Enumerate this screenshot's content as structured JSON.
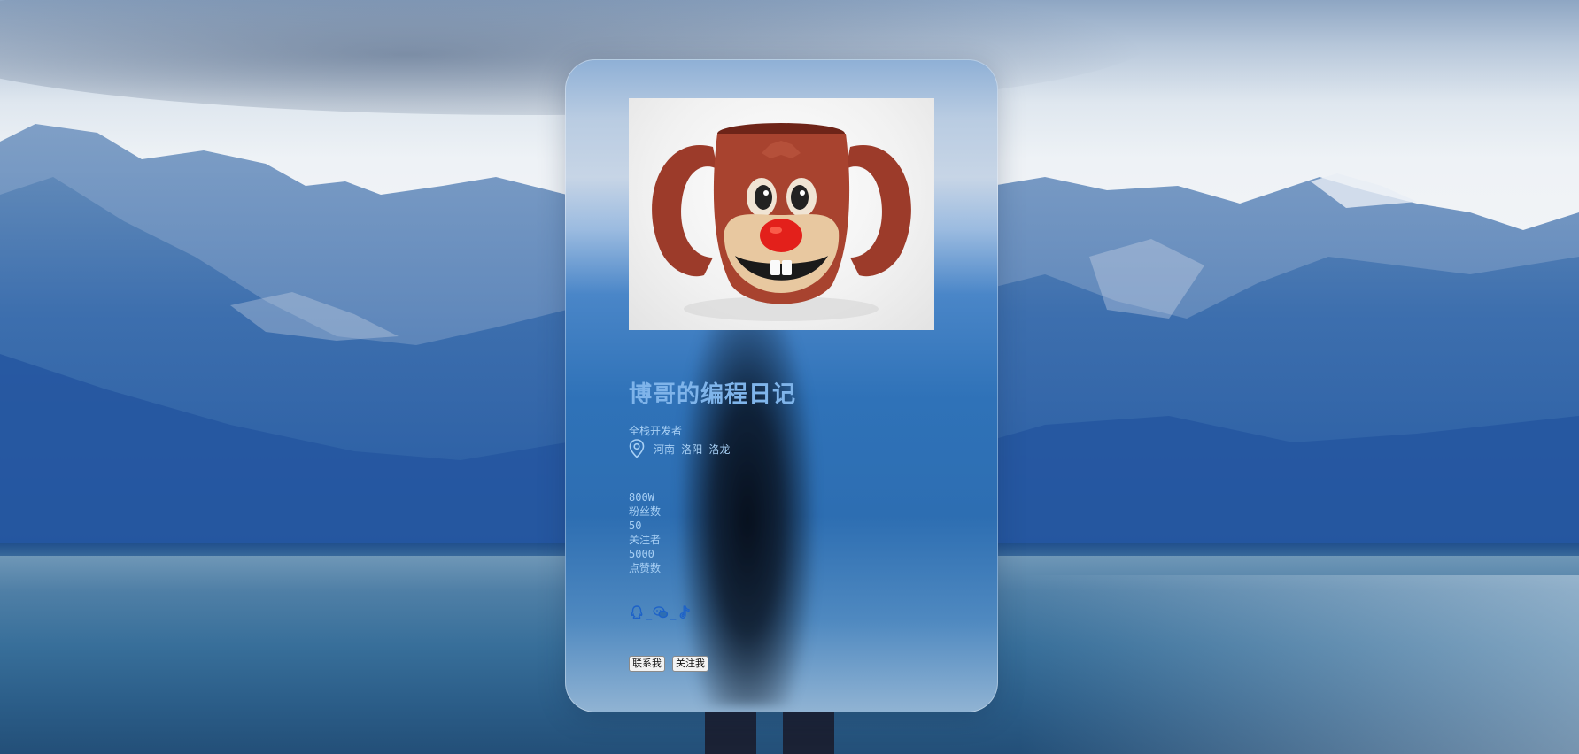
{
  "profile": {
    "name": "博哥的编程日记",
    "role": "全栈开发者",
    "location": "河南-洛阳-洛龙"
  },
  "stats": [
    {
      "value": "800W",
      "label": "粉丝数"
    },
    {
      "value": "50",
      "label": "关注者"
    },
    {
      "value": "5000",
      "label": "点赞数"
    }
  ],
  "socials": {
    "icons": [
      "qq-icon",
      "wechat-icon",
      "tiktok-icon"
    ],
    "separator": "_"
  },
  "buttons": {
    "contact_label": "联系我",
    "follow_label": "关注我"
  },
  "colors": {
    "accent_text": "#a8d0f5",
    "title": "#7fb4ea",
    "social_icon": "#1d62c8"
  }
}
